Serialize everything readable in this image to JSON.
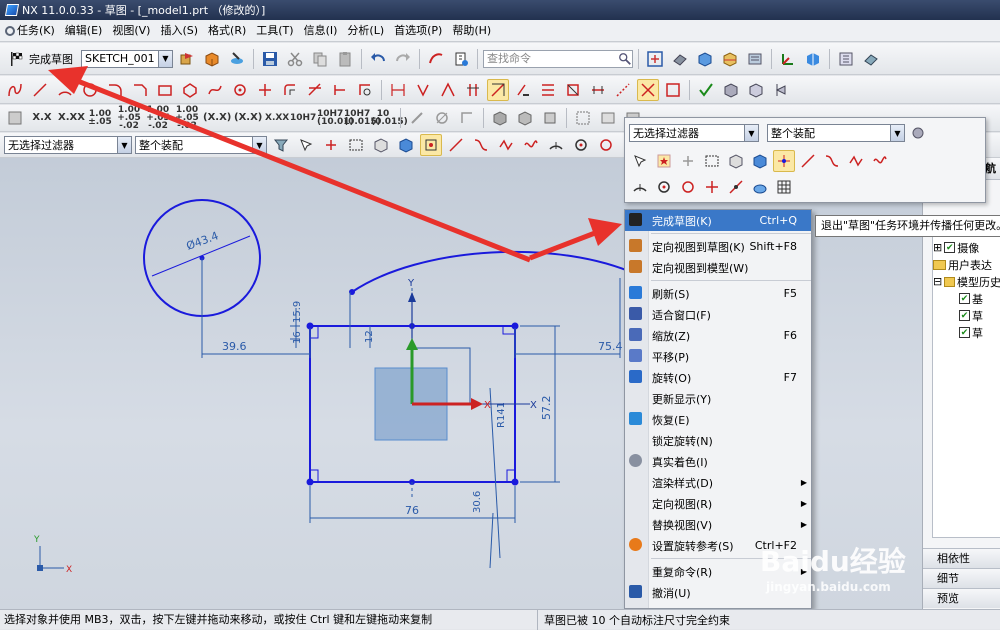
{
  "window": {
    "title": "NX 11.0.0.33 - 草图 - [_model1.prt （修改的）]"
  },
  "menu": {
    "items": [
      "任务(K)",
      "编辑(E)",
      "视图(V)",
      "插入(S)",
      "格式(R)",
      "工具(T)",
      "信息(I)",
      "分析(L)",
      "首选项(P)",
      "帮助(H)"
    ]
  },
  "toolbar": {
    "finish_sketch_label": "完成草图",
    "sketch_name": "SKETCH_001",
    "search_placeholder": "查找命令",
    "tolerance_labels": [
      "X.X",
      "X.XX",
      "1.00 ±.05",
      "1.00 +.05 -.02",
      "1.00 +.05 -.02",
      "1.00 +.05 -.02",
      "(X.X)",
      "(X.X)",
      "X.XX",
      "10H7",
      "10H7 (10.01)",
      "10H7 (0.015)",
      "10 (0.015)"
    ]
  },
  "selection_bar": {
    "filter": "无选择过滤器",
    "assembly": "整个装配"
  },
  "minibar": {
    "filter": "无选择过滤器",
    "assembly": "整个装配"
  },
  "context_menu": {
    "items": [
      {
        "label": "完成草图(K)",
        "shortcut": "Ctrl+Q",
        "icon": "flag-icon",
        "active": true
      },
      {
        "separator": true
      },
      {
        "label": "定向视图到草图(K)",
        "shortcut": "Shift+F8",
        "icon": "orient-sketch-icon"
      },
      {
        "label": "定向视图到模型(W)",
        "shortcut": "",
        "icon": "orient-model-icon"
      },
      {
        "separator": true
      },
      {
        "label": "刷新(S)",
        "shortcut": "F5",
        "icon": "refresh-icon"
      },
      {
        "label": "适合窗口(F)",
        "shortcut": "",
        "icon": "fit-icon"
      },
      {
        "label": "缩放(Z)",
        "shortcut": "F6",
        "icon": "zoom-icon"
      },
      {
        "label": "平移(P)",
        "shortcut": "",
        "icon": "pan-icon"
      },
      {
        "label": "旋转(O)",
        "shortcut": "F7",
        "icon": "rotate-icon"
      },
      {
        "label": "更新显示(Y)",
        "shortcut": "",
        "icon": ""
      },
      {
        "label": "恢复(E)",
        "shortcut": "",
        "icon": "restore-icon"
      },
      {
        "label": "锁定旋转(N)",
        "shortcut": "",
        "icon": ""
      },
      {
        "label": "真实着色(I)",
        "shortcut": "",
        "icon": "shade-icon"
      },
      {
        "label": "渲染样式(D)",
        "shortcut": "",
        "icon": "",
        "submenu": true
      },
      {
        "label": "定向视图(R)",
        "shortcut": "",
        "icon": "",
        "submenu": true
      },
      {
        "label": "替换视图(V)",
        "shortcut": "",
        "icon": "",
        "submenu": true
      },
      {
        "label": "设置旋转参考(S)",
        "shortcut": "Ctrl+F2",
        "icon": "rotate-ref-icon"
      },
      {
        "separator": true
      },
      {
        "label": "重复命令(R)",
        "shortcut": "",
        "icon": "",
        "submenu": true
      },
      {
        "label": "撤消(U)",
        "shortcut": "",
        "icon": "undo-icon"
      }
    ]
  },
  "tooltip": {
    "text": "退出\"草图\"任务环境并传播任何更改。"
  },
  "right_panel": {
    "header": "航",
    "tree": [
      "摄像",
      "用户表达",
      "模型历史",
      "基",
      "草",
      "草"
    ],
    "sections": [
      "相依性",
      "细节",
      "预览"
    ]
  },
  "sketch": {
    "dims": [
      "Ø43.4",
      "39.6",
      "75.4",
      "15.9",
      "16",
      "12",
      "57.2",
      "R141",
      "76",
      "30.6"
    ],
    "axis_x": "X",
    "axis_y": "Y"
  },
  "status": {
    "left": "选择对象并使用 MB3，双击，按下左键并拖动来移动，或按住 Ctrl 键和左键拖动来复制",
    "right": "草图已被 10 个自动标注尺寸完全约束"
  },
  "watermark": {
    "brand": "Baidu经验",
    "url": "jingyan.baidu.com"
  },
  "colors": {
    "accent": "#3a78c8",
    "sketch": "#1a1adc",
    "arrow": "#e8322c"
  }
}
